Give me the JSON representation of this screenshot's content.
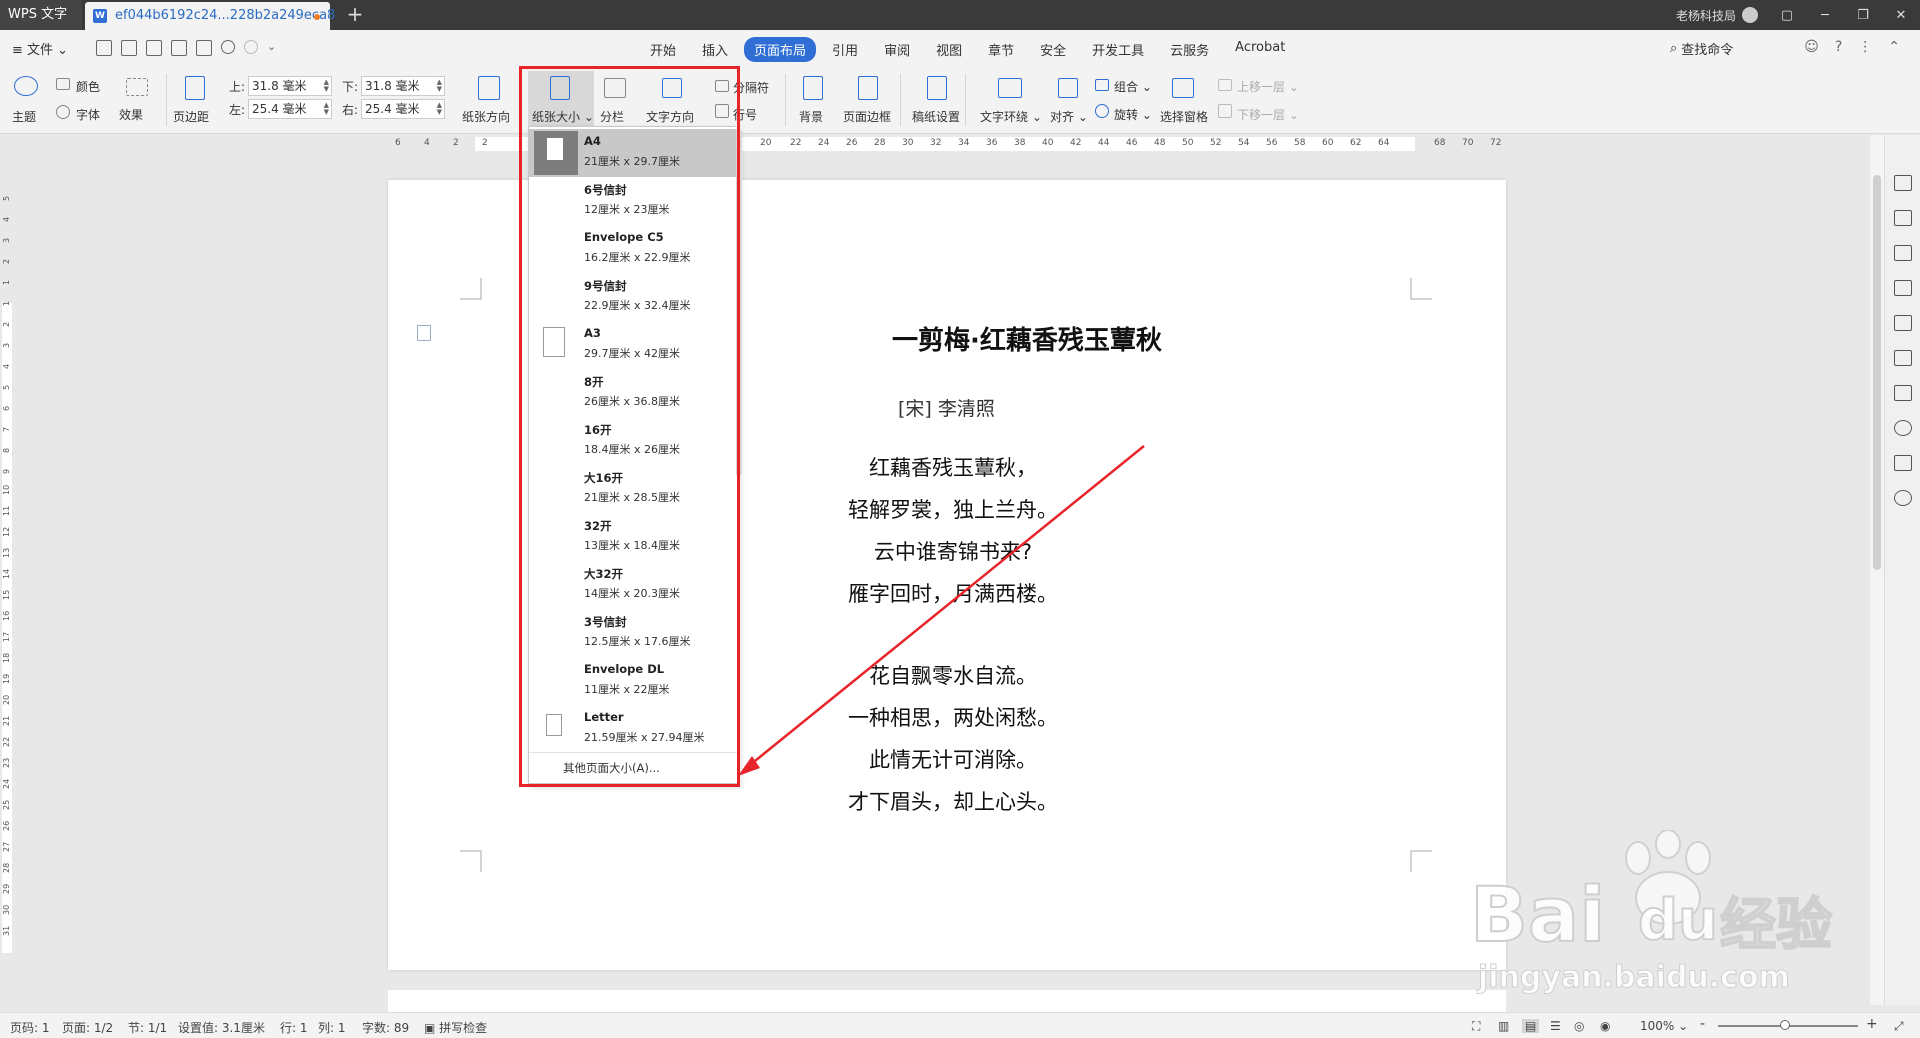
{
  "titlebar": {
    "app_tab": "WPS 文字",
    "doc_tab": "ef044b6192c24...228b2a249eca8",
    "new_tab": "+",
    "user": "老杨科技局",
    "window_controls": [
      "▢",
      "─",
      "❐",
      "✕"
    ]
  },
  "menubar": {
    "file": "≡ 文件 ⌄",
    "tabs": [
      "开始",
      "插入",
      "页面布局",
      "引用",
      "审阅",
      "视图",
      "章节",
      "安全",
      "开发工具",
      "云服务",
      "Acrobat"
    ],
    "active_tab": "页面布局",
    "find": "查找命令",
    "accent": "#2f6ed4"
  },
  "ribbon": {
    "theme": "主题",
    "color": "颜色",
    "font": "字体",
    "effect": "效果",
    "margins": "页边距",
    "top_label": "上:",
    "top_value": "31.8 毫米",
    "bottom_label": "下:",
    "bottom_value": "31.8 毫米",
    "left_label": "左:",
    "left_value": "25.4 毫米",
    "right_label": "右:",
    "right_value": "25.4 毫米",
    "orientation": "纸张方向",
    "paper_size": "纸张大小",
    "columns": "分栏",
    "text_direction": "文字方向",
    "separator": "分隔符",
    "line_numbers": "行号",
    "background": "背景",
    "page_border": "页面边框",
    "manuscript": "稿纸设置",
    "text_wrap": "文字环绕",
    "align": "对齐",
    "group": "组合",
    "rotate": "旋转",
    "selection_pane": "选择窗格",
    "bring_forward": "上移一层",
    "send_backward": "下移一层"
  },
  "hruler_ticks": [
    "6",
    "4",
    "2",
    "2",
    "20",
    "22",
    "24",
    "26",
    "28",
    "30",
    "32",
    "34",
    "36",
    "38",
    "40",
    "42",
    "44",
    "46",
    "48",
    "50",
    "52",
    "54",
    "56",
    "58",
    "60",
    "62",
    "64",
    "68",
    "70",
    "72"
  ],
  "vruler_ticks": [
    "5",
    "4",
    "3",
    "2",
    "1",
    "1",
    "2",
    "3",
    "4",
    "5",
    "6",
    "7",
    "8",
    "9",
    "10",
    "11",
    "12",
    "13",
    "14",
    "15",
    "16",
    "17",
    "18",
    "19",
    "20",
    "21",
    "22",
    "23",
    "24",
    "25",
    "26",
    "27",
    "28",
    "29",
    "30",
    "31"
  ],
  "document": {
    "title": "一剪梅·红藕香残玉蕈秋",
    "author": "[宋]  李清照",
    "stanza1": [
      "红藕香残玉蕈秋，",
      "轻解罗裳，独上兰舟。",
      "云中谁寄锦书来?",
      "雁字回时，月满西楼。"
    ],
    "stanza2": [
      "花自飘零水自流。",
      "一种相思，两处闲愁。",
      "此情无计可消除。",
      "才下眉头，却上心头。"
    ]
  },
  "paper_menu": {
    "options": [
      {
        "name": "A4",
        "dims": "21厘米  x  29.7厘米",
        "selected": true,
        "icon": "a4"
      },
      {
        "name": "6号信封",
        "dims": "12厘米  x  23厘米",
        "icon": "none"
      },
      {
        "name": "Envelope C5",
        "dims": "16.2厘米  x  22.9厘米",
        "icon": "none"
      },
      {
        "name": "9号信封",
        "dims": "22.9厘米  x  32.4厘米",
        "icon": "none"
      },
      {
        "name": "A3",
        "dims": "29.7厘米  x  42厘米",
        "icon": "a3"
      },
      {
        "name": "8开",
        "dims": "26厘米  x  36.8厘米",
        "icon": "none"
      },
      {
        "name": "16开",
        "dims": "18.4厘米  x  26厘米",
        "icon": "none"
      },
      {
        "name": "大16开",
        "dims": "21厘米  x  28.5厘米",
        "icon": "none"
      },
      {
        "name": "32开",
        "dims": "13厘米  x  18.4厘米",
        "icon": "none"
      },
      {
        "name": "大32开",
        "dims": "14厘米  x  20.3厘米",
        "icon": "none"
      },
      {
        "name": "3号信封",
        "dims": "12.5厘米  x  17.6厘米",
        "icon": "none"
      },
      {
        "name": "Envelope DL",
        "dims": "11厘米  x  22厘米",
        "icon": "none"
      },
      {
        "name": "Letter",
        "dims": "21.59厘米  x  27.94厘米",
        "icon": "letter"
      }
    ],
    "more": "其他页面大小(A)..."
  },
  "statusbar": {
    "page_code": "页码: 1",
    "page": "页面: 1/2",
    "section": "节: 1/1",
    "setting": "设置值: 3.1厘米",
    "row": "行: 1",
    "col": "列: 1",
    "words": "字数: 89",
    "spell": "拼写检查",
    "zoom": "100%",
    "zoom_minus": "-",
    "zoom_plus": "+"
  },
  "watermark": {
    "brand": "Bai",
    "brand2": "du",
    "cn": "经验",
    "url": "jingyan.baidu.com"
  },
  "annotation_color": "#e8242b"
}
